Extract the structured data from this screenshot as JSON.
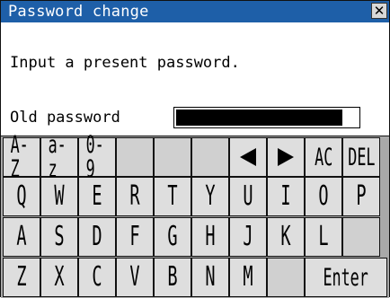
{
  "dialog": {
    "title": "Password change",
    "close_label": "✕",
    "message": "Input a present password.",
    "field_label": "Old password"
  },
  "keyboard": {
    "rows": [
      [
        "A-Z",
        "a-z",
        "0-9",
        "",
        "",
        "",
        "◀",
        "▶",
        "AC",
        "DEL"
      ],
      [
        "Q",
        "W",
        "E",
        "R",
        "T",
        "Y",
        "U",
        "I",
        "O",
        "P"
      ],
      [
        "A",
        "S",
        "D",
        "F",
        "G",
        "H",
        "J",
        "K",
        "L",
        ""
      ],
      [
        "Z",
        "X",
        "C",
        "V",
        "B",
        "N",
        "M",
        "",
        "Enter"
      ]
    ]
  },
  "colors": {
    "titlebar": "#1e5fa8",
    "key_face": "#dedede",
    "keyboard_bg": "#a9a9a9"
  }
}
